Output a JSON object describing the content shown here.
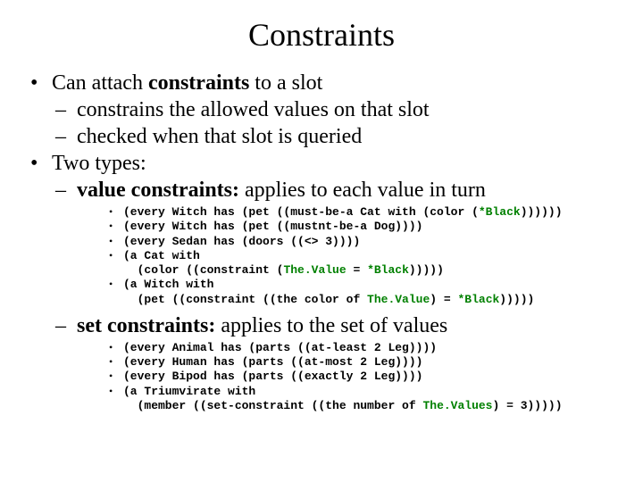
{
  "title": "Constraints",
  "bullets": {
    "b1_pre": "Can attach ",
    "b1_bold": "constraints",
    "b1_post": " to a slot",
    "b1_s1": "constrains the allowed values on that slot",
    "b1_s2": "checked when that slot is queried",
    "b2": "Two types:",
    "b2_s1_bold": "value constraints:",
    "b2_s1_post": " applies to each value in turn",
    "b2_s2_bold": "set constraints:",
    "b2_s2_post": " applies to the set of values"
  },
  "value_code": {
    "l1a": "(every Witch has (pet ((must-be-a Cat with (color (",
    "l1b": "*Black",
    "l1c": "))))))",
    "l2": "(every Witch has (pet ((mustnt-be-a Dog))))",
    "l3": "(every Sedan has (doors ((<> 3))))",
    "l4a": "(a Cat with\n  (color ((constraint (",
    "l4b": "The.Value",
    "l4c": " = ",
    "l4d": "*Black",
    "l4e": ")))))",
    "l5a": "(a Witch with\n  (pet ((constraint ((the color of ",
    "l5b": "The.Value",
    "l5c": ") = ",
    "l5d": "*Black",
    "l5e": ")))))"
  },
  "set_code": {
    "l1": "(every Animal has (parts ((at-least 2 Leg))))",
    "l2": "(every Human has (parts ((at-most 2 Leg))))",
    "l3": "(every Bipod has (parts ((exactly 2 Leg))))",
    "l4a": "(a Triumvirate with\n  (member ((set-constraint ((the number of ",
    "l4b": "The.Values",
    "l4c": ") = 3)))))"
  }
}
